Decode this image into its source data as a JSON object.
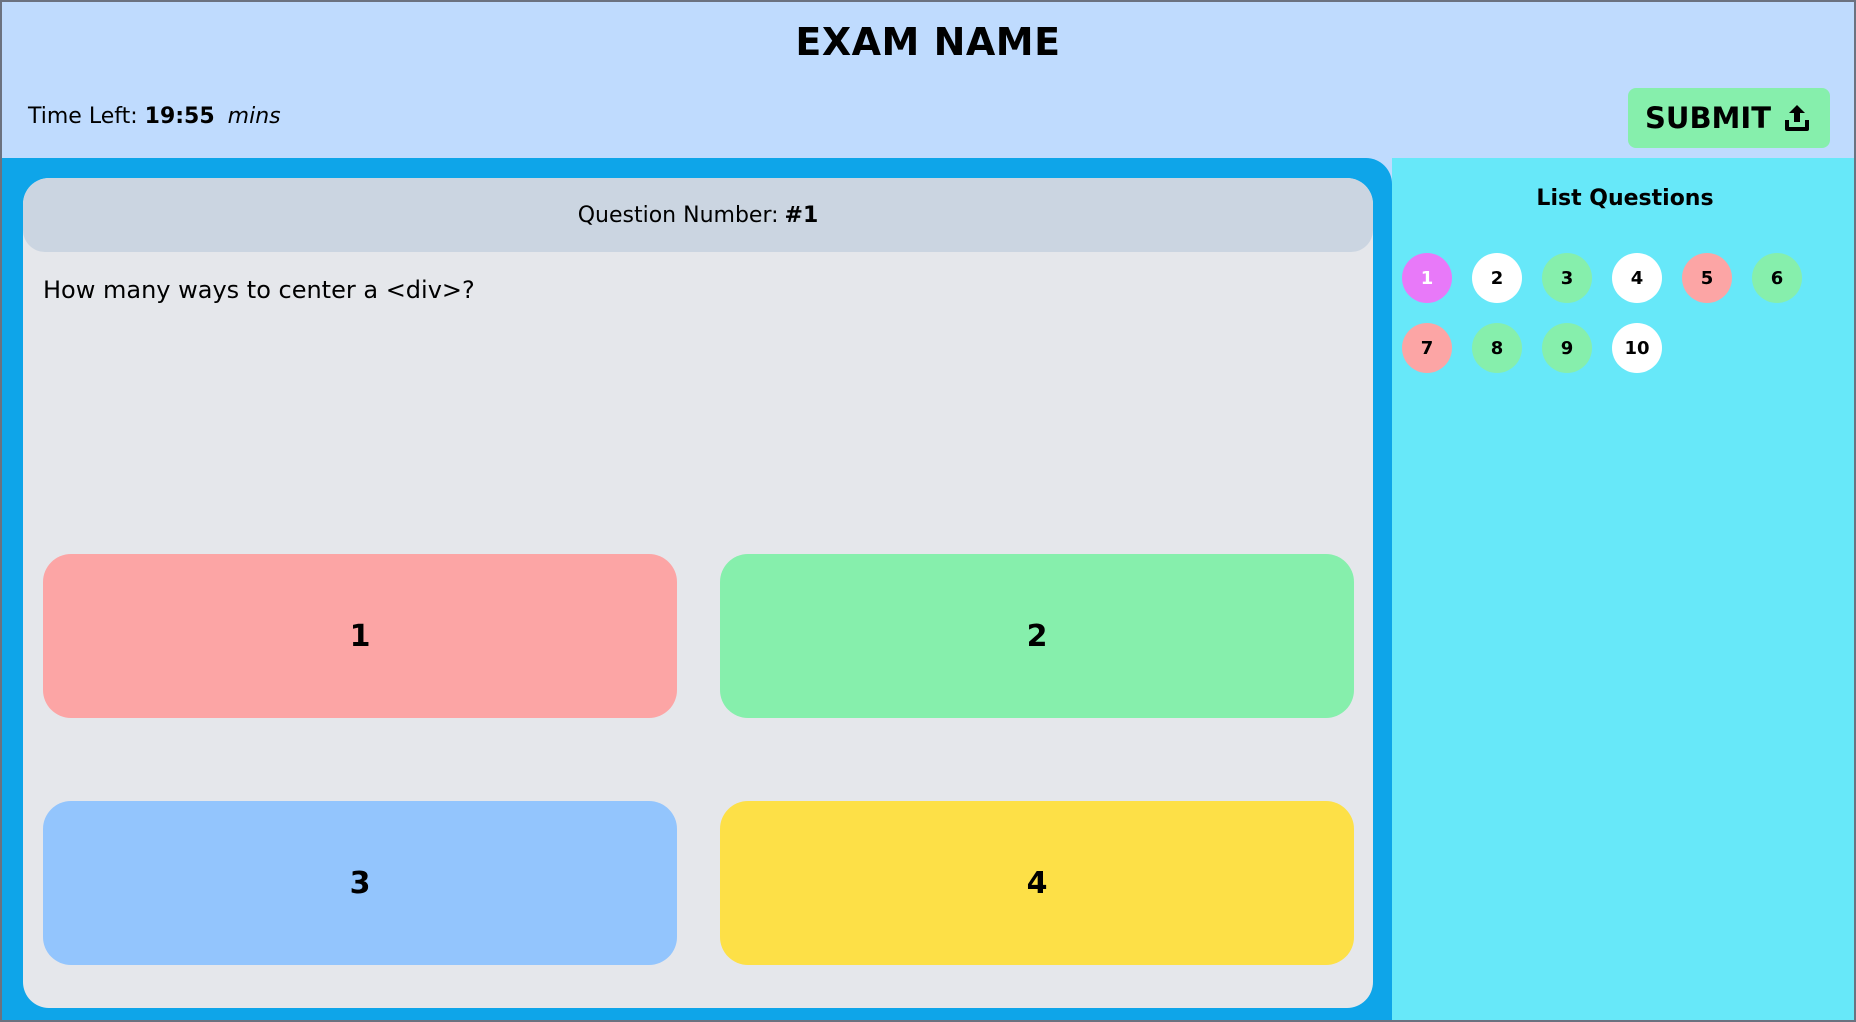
{
  "header": {
    "title": "EXAM NAME",
    "time_label": "Time Left:",
    "time_value": "19:55",
    "time_unit": "mins",
    "submit_label": "SUBMIT",
    "submit_icon": "upload-icon"
  },
  "question": {
    "number_label": "Question Number:",
    "number_value": "#1",
    "text": "How many ways to center a <div>?",
    "options": [
      {
        "label": "1",
        "color": "#fca5a5"
      },
      {
        "label": "2",
        "color": "#86efac"
      },
      {
        "label": "3",
        "color": "#93c5fd"
      },
      {
        "label": "4",
        "color": "#fde047"
      }
    ]
  },
  "sidebar": {
    "title": "List Questions",
    "questions": [
      {
        "label": "1",
        "status": "current"
      },
      {
        "label": "2",
        "status": "unanswered"
      },
      {
        "label": "3",
        "status": "answered"
      },
      {
        "label": "4",
        "status": "unanswered"
      },
      {
        "label": "5",
        "status": "flagged"
      },
      {
        "label": "6",
        "status": "answered"
      },
      {
        "label": "7",
        "status": "flagged"
      },
      {
        "label": "8",
        "status": "answered"
      },
      {
        "label": "9",
        "status": "answered"
      },
      {
        "label": "10",
        "status": "unanswered"
      }
    ]
  },
  "colors": {
    "header_bg": "#bfdbfe",
    "main_bg": "#0ea5e9",
    "sidebar_bg": "#67e8f9",
    "card_bg": "#e5e7eb",
    "current": "#e879f9",
    "answered": "#86efac",
    "flagged": "#fca5a5",
    "unanswered": "#ffffff"
  }
}
